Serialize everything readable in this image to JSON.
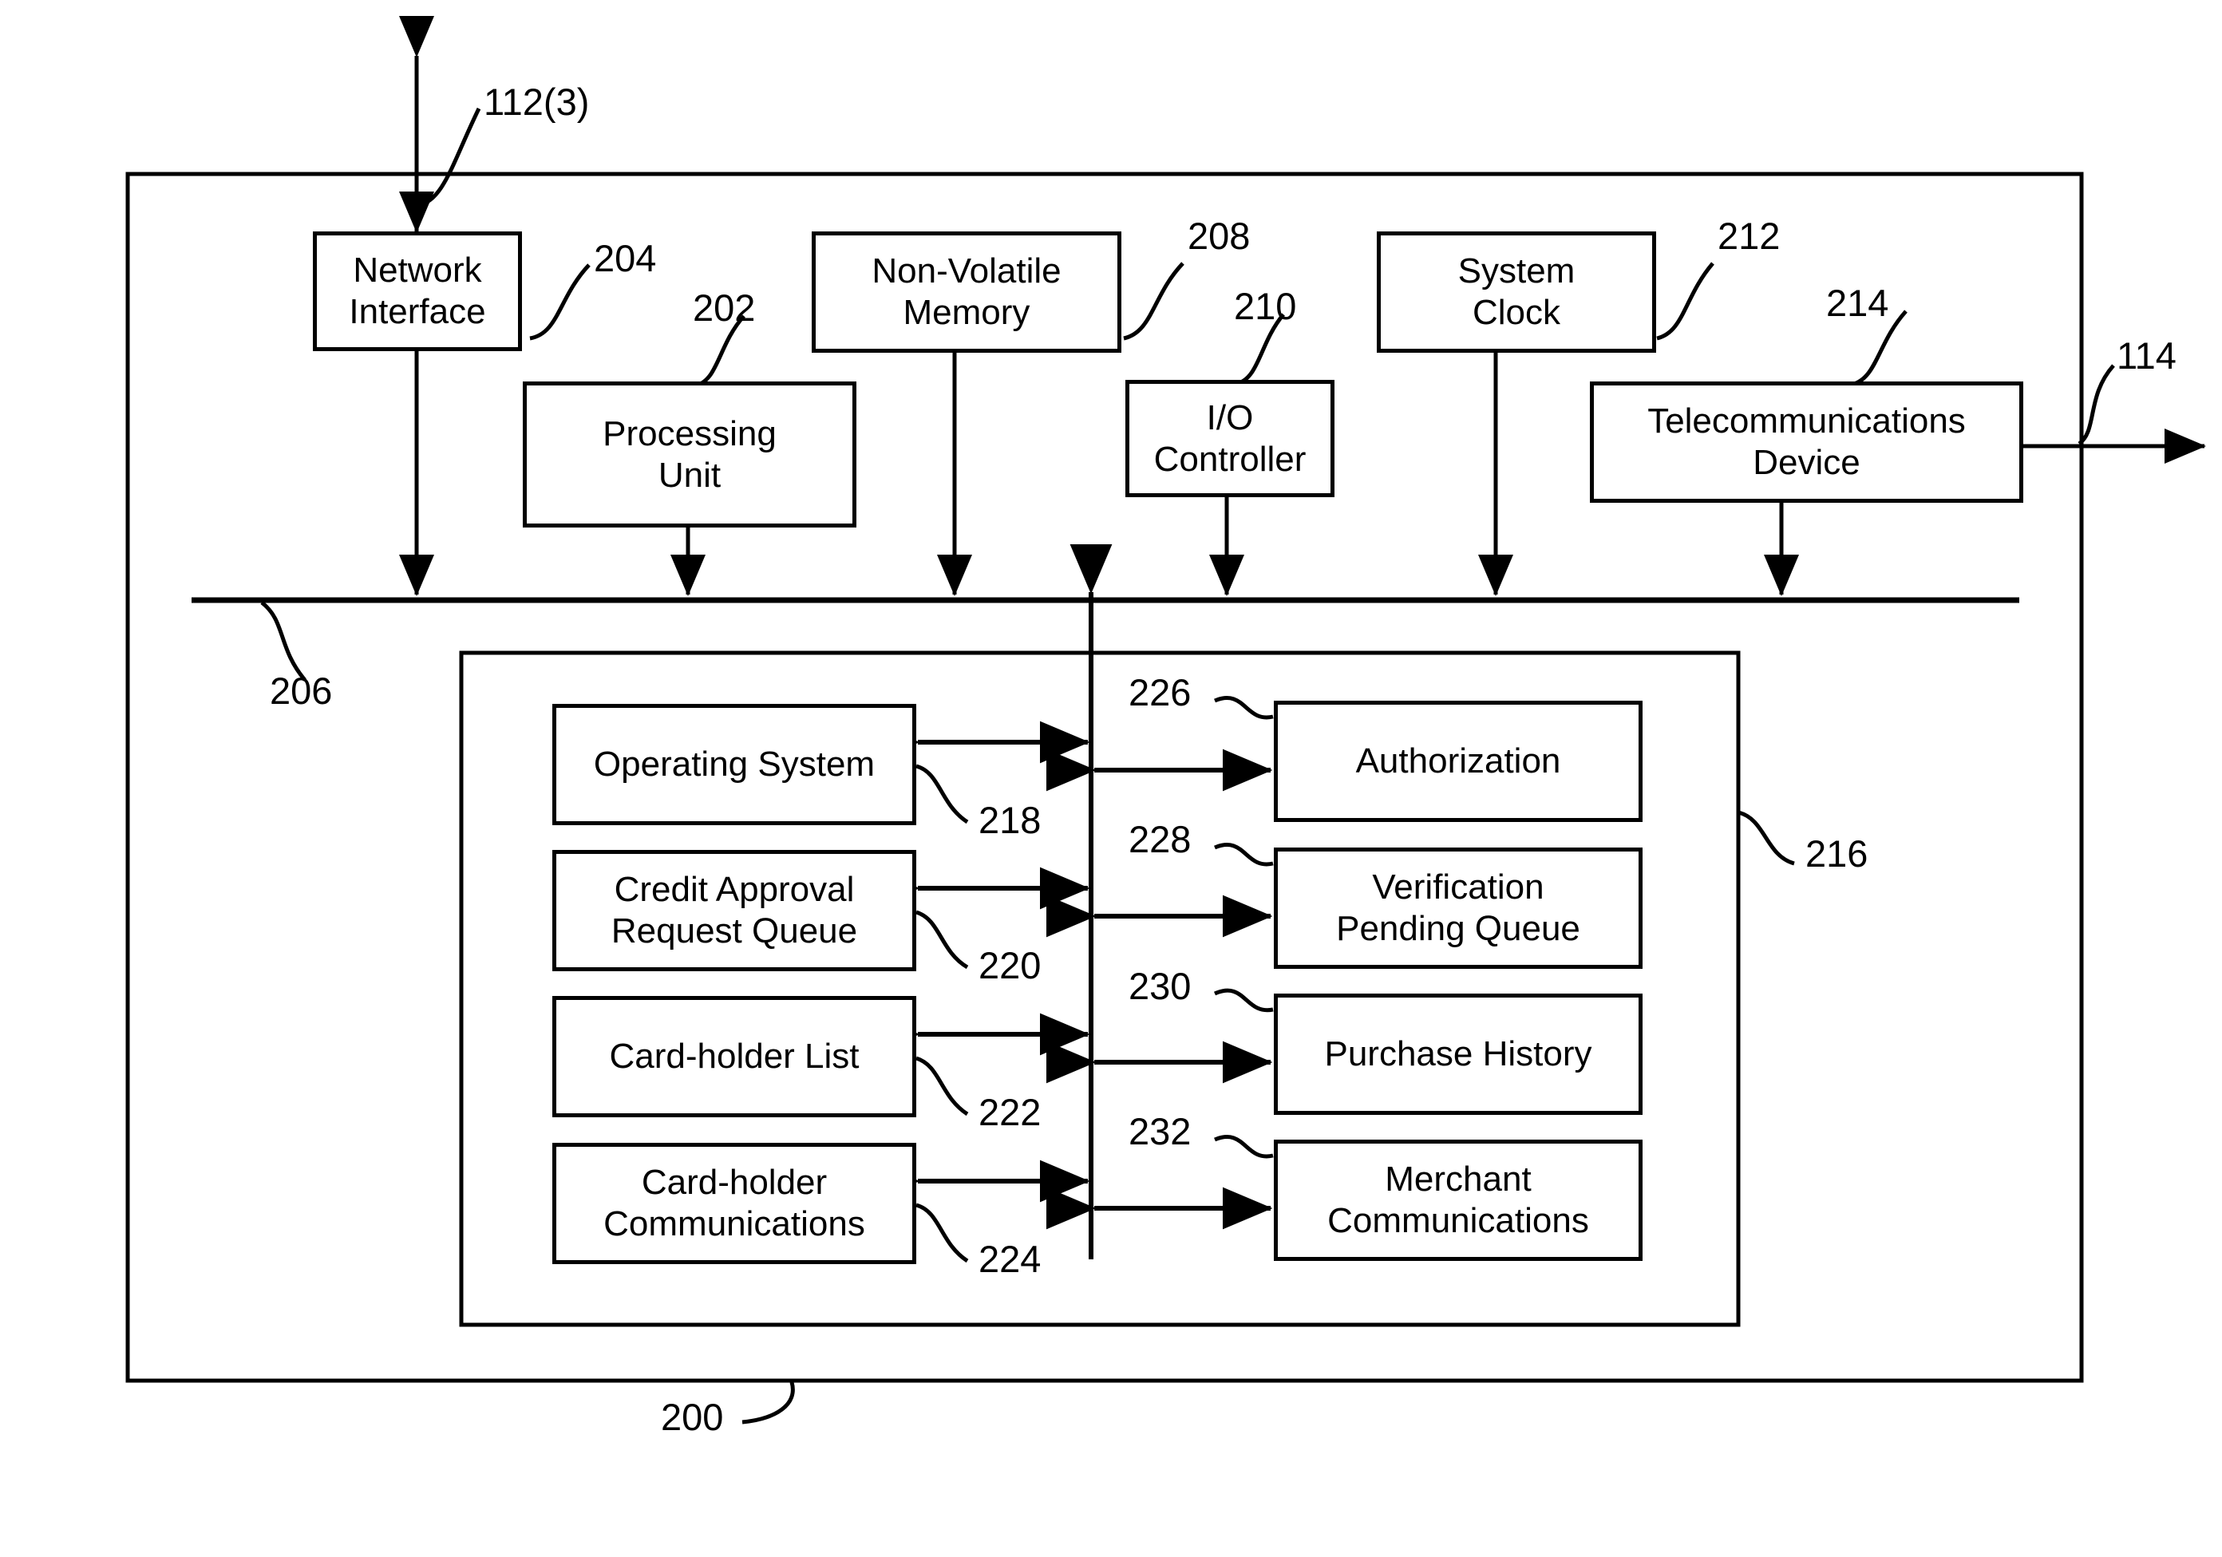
{
  "figure": {
    "type": "patent-block-diagram",
    "outer_ref": "200",
    "bus_ref": "206",
    "memory_ref": "216",
    "external_link_top": "112(3)",
    "external_link_right": "114"
  },
  "components": {
    "network_interface": {
      "label": "Network\nInterface",
      "line1": "Network",
      "line2": "Interface",
      "ref": "204"
    },
    "processing_unit": {
      "label": "Processing\nUnit",
      "line1": "Processing",
      "line2": "Unit",
      "ref": "202"
    },
    "non_volatile_memory": {
      "label": "Non-Volatile\nMemory",
      "line1": "Non-Volatile",
      "line2": "Memory",
      "ref": "208"
    },
    "io_controller": {
      "label": "I/O\nController",
      "line1": "I/O",
      "line2": "Controller",
      "ref": "210"
    },
    "system_clock": {
      "label": "System\nClock",
      "line1": "System",
      "line2": "Clock",
      "ref": "212"
    },
    "telecommunications_device": {
      "label": "Telecommunications\nDevice",
      "line1": "Telecommunications",
      "line2": "Device",
      "ref": "214"
    }
  },
  "memory_modules": {
    "left_column": [
      {
        "line1": "Operating System",
        "line2": "",
        "ref": "218"
      },
      {
        "line1": "Credit Approval",
        "line2": "Request Queue",
        "ref": "220"
      },
      {
        "line1": "Card-holder List",
        "line2": "",
        "ref": "222"
      },
      {
        "line1": "Card-holder",
        "line2": "Communications",
        "ref": "224"
      }
    ],
    "right_column": [
      {
        "line1": "Authorization",
        "line2": "",
        "ref": "226"
      },
      {
        "line1": "Verification",
        "line2": "Pending Queue",
        "ref": "228"
      },
      {
        "line1": "Purchase History",
        "line2": "",
        "ref": "230"
      },
      {
        "line1": "Merchant",
        "line2": "Communications",
        "ref": "232"
      }
    ]
  }
}
